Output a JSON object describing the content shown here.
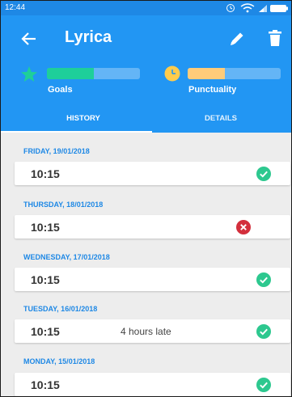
{
  "statusbar": {
    "time": "12:44"
  },
  "header": {
    "title": "Lyrica"
  },
  "stats": [
    {
      "label": "Goals",
      "fill_fraction": 0.5,
      "fill_color": "#1ecf9a"
    },
    {
      "label": "Punctuality",
      "fill_fraction": 0.4,
      "fill_color": "#ffcc7a"
    }
  ],
  "tabs": [
    {
      "label": "HISTORY",
      "selected": true
    },
    {
      "label": "DETAILS",
      "selected": false
    }
  ],
  "colors": {
    "accent": "#2296f3",
    "on_time": "#2dc88f",
    "missed": "#d32f3c"
  },
  "history": [
    {
      "date": "FRIDAY, 19/01/2018",
      "time": "10:15",
      "note": "",
      "status": "on-time",
      "status_icon": "check-circle-icon"
    },
    {
      "date": "THURSDAY, 18/01/2018",
      "time": "10:15",
      "note": "",
      "status": "missed",
      "status_icon": "cross-circle-icon"
    },
    {
      "date": "WEDNESDAY, 17/01/2018",
      "time": "10:15",
      "note": "",
      "status": "on-time",
      "status_icon": "check-circle-icon"
    },
    {
      "date": "TUESDAY, 16/01/2018",
      "time": "10:15",
      "note": "4 hours late",
      "status": "on-time",
      "status_icon": "check-circle-icon"
    },
    {
      "date": "MONDAY, 15/01/2018",
      "time": "10:15",
      "note": "",
      "status": "on-time",
      "status_icon": "check-circle-icon"
    }
  ]
}
